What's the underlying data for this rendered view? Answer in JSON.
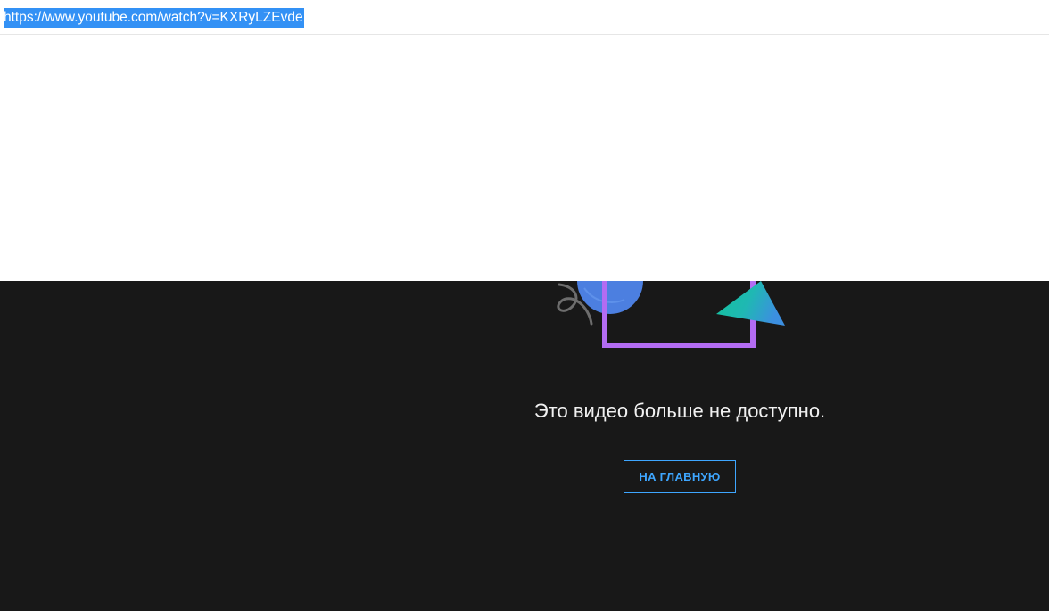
{
  "address_bar": {
    "url": "https://www.youtube.com/watch?v=KXRyLZEvde"
  },
  "error": {
    "message": "Это видео больше не доступно.",
    "home_button_label": "НА ГЛАВНУЮ"
  },
  "colors": {
    "panel_background": "#181818",
    "accent": "#3ea6ff",
    "url_selection": "#3391f5",
    "frame_purple": "#b36cf2",
    "circle_blue": "#4c7fe0",
    "triangle_teal": "#14c4a0"
  },
  "icons": {
    "illustration": "broken-video-illustration"
  }
}
